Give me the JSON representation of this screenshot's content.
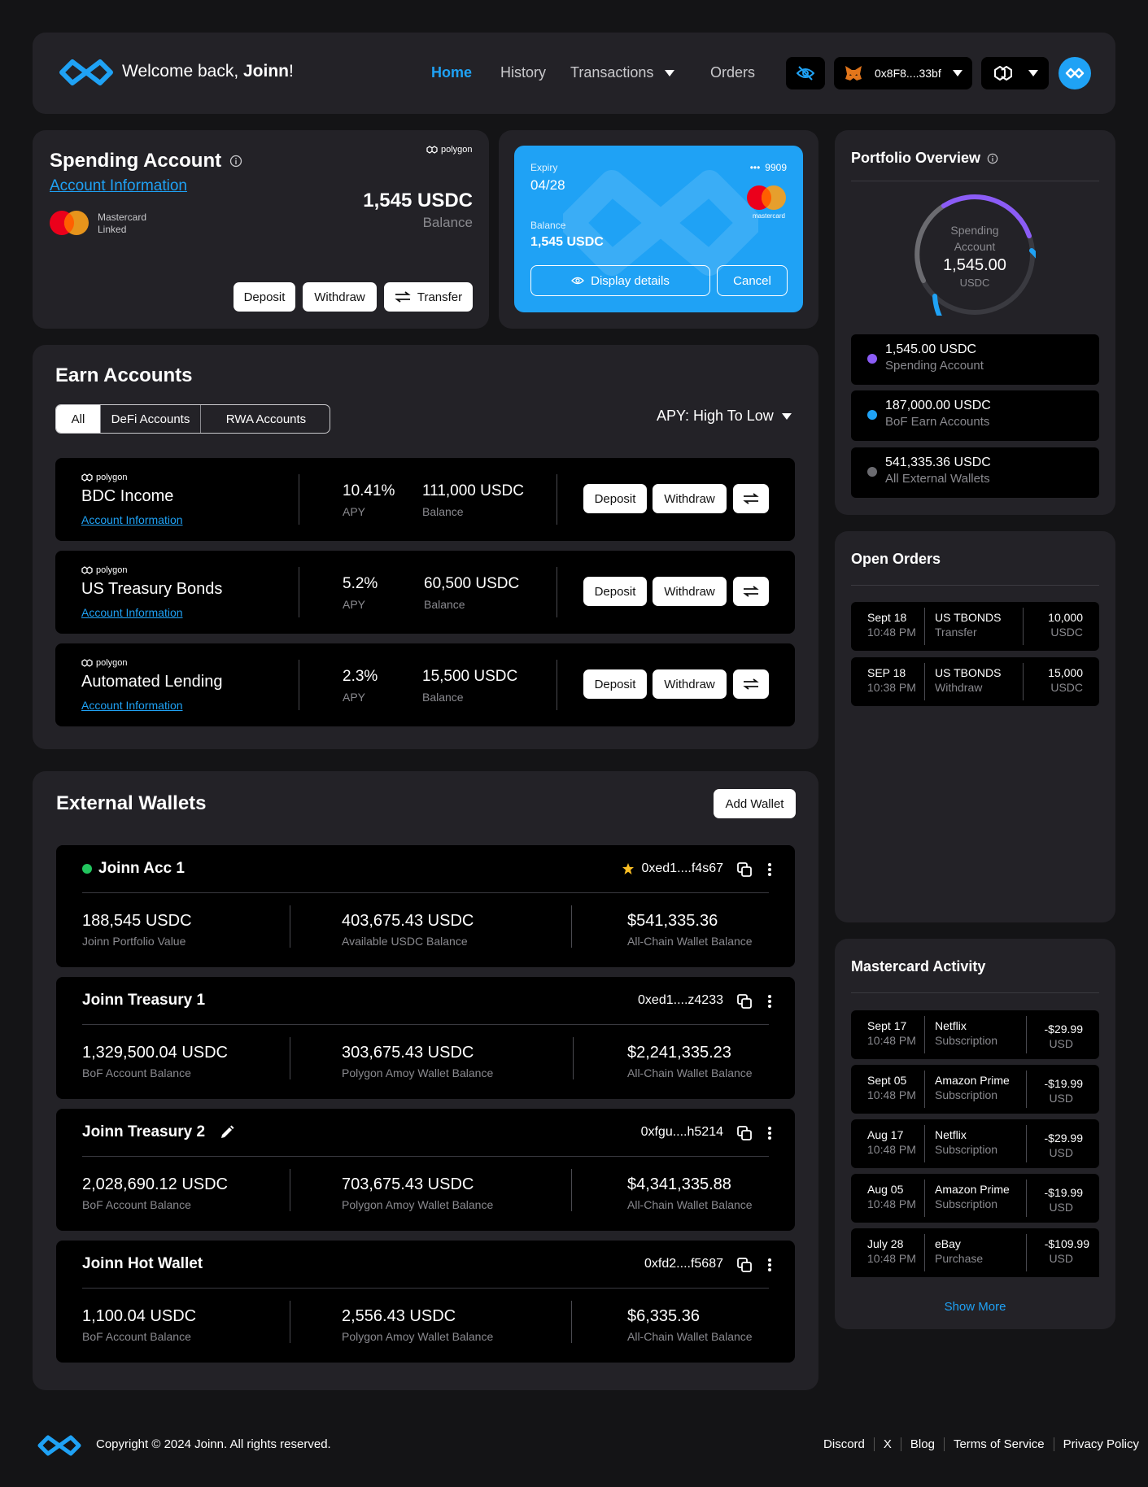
{
  "header": {
    "welcome_prefix": "Welcome back, ",
    "user_name": "Joinn",
    "welcome_suffix": "!",
    "nav": {
      "home": "Home",
      "history": "History",
      "transactions": "Transactions",
      "orders": "Orders"
    },
    "wallet_address": "0x8F8....33bf",
    "accent_color": "#1fa2f5"
  },
  "spending": {
    "title": "Spending Account",
    "account_info": "Account Information",
    "network": "polygon",
    "card_brand": "Mastercard",
    "card_status": "Linked",
    "balance_value": "1,545 USDC",
    "balance_label": "Balance",
    "deposit": "Deposit",
    "withdraw": "Withdraw",
    "transfer": "Transfer"
  },
  "card": {
    "expiry_label": "Expiry",
    "expiry": "04/28",
    "masked_dots": "•••",
    "last4": "9909",
    "balance_label": "Balance",
    "balance": "1,545 USDC",
    "brand": "mastercard",
    "display_details": "Display details",
    "cancel": "Cancel"
  },
  "earn": {
    "title": "Earn Accounts",
    "tabs": [
      "All",
      "DeFi Accounts",
      "RWA Accounts"
    ],
    "sort": "APY: High To Low",
    "rows": [
      {
        "network": "polygon",
        "name": "BDC Income",
        "info": "Account Information",
        "apy": "10.41%",
        "apy_label": "APY",
        "balance": "111,000 USDC",
        "balance_label": "Balance",
        "deposit": "Deposit",
        "withdraw": "Withdraw"
      },
      {
        "network": "polygon",
        "name": "US Treasury Bonds",
        "info": "Account Information",
        "apy": "5.2%",
        "apy_label": "APY",
        "balance": "60,500 USDC",
        "balance_label": "Balance",
        "deposit": "Deposit",
        "withdraw": "Withdraw"
      },
      {
        "network": "polygon",
        "name": "Automated Lending",
        "info": "Account Information",
        "apy": "2.3%",
        "apy_label": "APY",
        "balance": "15,500 USDC",
        "balance_label": "Balance",
        "deposit": "Deposit",
        "withdraw": "Withdraw"
      }
    ]
  },
  "wallets": {
    "title": "External Wallets",
    "add": "Add Wallet",
    "items": [
      {
        "name": "Joinn Acc 1",
        "address": "0xed1....f4s67",
        "v1": "188,545 USDC",
        "l1": "Joinn Portfolio Value",
        "v2": "403,675.43 USDC",
        "l2": "Available USDC Balance",
        "v3": "$541,335.36",
        "l3": "All-Chain Wallet Balance"
      },
      {
        "name": "Joinn Treasury 1",
        "address": "0xed1....z4233",
        "v1": "1,329,500.04 USDC",
        "l1": "BoF Account Balance",
        "v2": "303,675.43 USDC",
        "l2": "Polygon Amoy Wallet Balance",
        "v3": "$2,241,335.23",
        "l3": "All-Chain Wallet Balance"
      },
      {
        "name": "Joinn Treasury 2",
        "address": "0xfgu....h5214",
        "v1": "2,028,690.12 USDC",
        "l1": "BoF Account Balance",
        "v2": "703,675.43 USDC",
        "l2": "Polygon Amoy Wallet Balance",
        "v3": "$4,341,335.88",
        "l3": "All-Chain Wallet Balance"
      },
      {
        "name": "Joinn Hot Wallet",
        "address": "0xfd2....f5687",
        "v1": "1,100.04 USDC",
        "l1": "BoF Account Balance",
        "v2": "2,556.43 USDC",
        "l2": "Polygon Amoy Wallet Balance",
        "v3": "$6,335.36",
        "l3": "All-Chain Wallet Balance"
      }
    ]
  },
  "portfolio": {
    "title": "Portfolio Overview",
    "center_label_1": "Spending",
    "center_label_2": "Account",
    "center_value": "1,545.00",
    "center_unit": "USDC",
    "legend": [
      {
        "value": "1,545.00 USDC",
        "label": "Spending Account",
        "color": "#8b5cf6"
      },
      {
        "value": "187,000.00 USDC",
        "label": "BoF Earn Accounts",
        "color": "#1fa2f5"
      },
      {
        "value": "541,335.36 USDC",
        "label": "All External Wallets",
        "color": "#6b6b70"
      }
    ]
  },
  "orders": {
    "title": "Open Orders",
    "rows": [
      {
        "date": "Sept 18",
        "time": "10:48 PM",
        "asset": "US TBONDS",
        "type": "Transfer",
        "amount": "10,000",
        "unit": "USDC"
      },
      {
        "date": "SEP 18",
        "time": "10:38 PM",
        "asset": "US TBONDS",
        "type": "Withdraw",
        "amount": "15,000",
        "unit": "USDC"
      }
    ]
  },
  "activity": {
    "title": "Mastercard Activity",
    "show_more": "Show More",
    "rows": [
      {
        "date": "Sept 17",
        "time": "10:48 PM",
        "merchant": "Netflix",
        "kind": "Subscription",
        "amount": "-$29.99",
        "unit": "USD"
      },
      {
        "date": "Sept 05",
        "time": "10:48 PM",
        "merchant": "Amazon Prime",
        "kind": "Subscription",
        "amount": "-$19.99",
        "unit": "USD"
      },
      {
        "date": "Aug 17",
        "time": "10:48 PM",
        "merchant": "Netflix",
        "kind": "Subscription",
        "amount": "-$29.99",
        "unit": "USD"
      },
      {
        "date": "Aug 05",
        "time": "10:48 PM",
        "merchant": "Amazon Prime",
        "kind": "Subscription",
        "amount": "-$19.99",
        "unit": "USD"
      },
      {
        "date": "July 28",
        "time": "10:48 PM",
        "merchant": "eBay",
        "kind": "Purchase",
        "amount": "-$109.99",
        "unit": "USD"
      }
    ]
  },
  "footer": {
    "copyright": "Copyright © 2024 Joinn. All rights reserved.",
    "links": [
      "Discord",
      "X",
      "Blog",
      "Terms of Service",
      "Privacy Policy"
    ]
  }
}
